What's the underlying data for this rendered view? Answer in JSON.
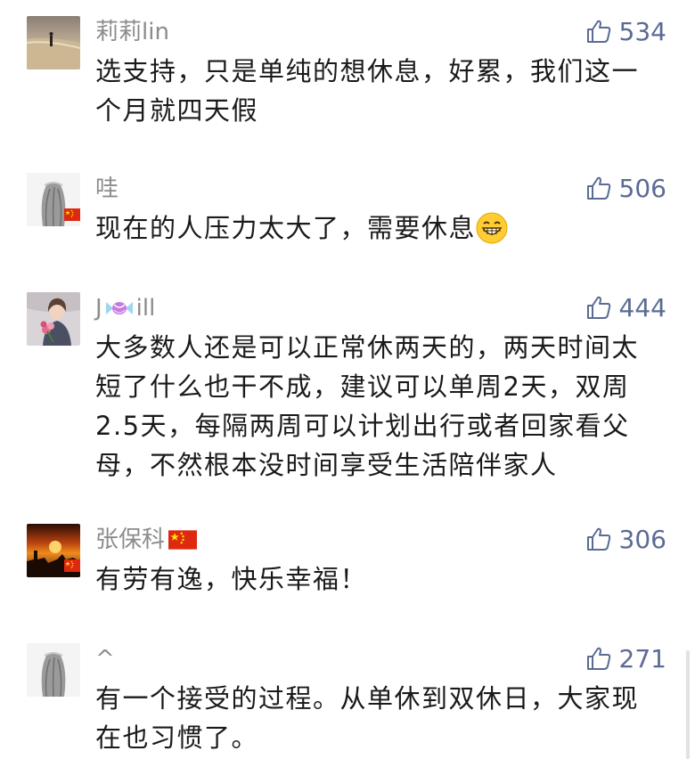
{
  "comments": [
    {
      "username": "莉莉lin",
      "likes": "534",
      "lines": [
        "选支持，只是单纯的想休息，好累，我们这一",
        "个月就四天假"
      ]
    },
    {
      "username": "哇",
      "likes": "506",
      "lines": [
        "现在的人压力太大了，需要休息"
      ],
      "emoji": "grinning-face-emoji"
    },
    {
      "username_prefix": "J",
      "username_suffix": "ill",
      "username_icon": "candy-icon",
      "likes": "444",
      "lines": [
        "大多数人还是可以正常休两天的，两天时间太",
        "短了什么也干不成，建议可以单周2天，双周",
        "2.5天，每隔两周可以计划出行或者回家看父",
        "母，不然根本没时间享受生活陪伴家人"
      ]
    },
    {
      "username": "张保科",
      "username_icon": "china-flag-icon",
      "likes": "306",
      "lines": [
        "有劳有逸，快乐幸福！"
      ]
    },
    {
      "username": "^",
      "likes": "271",
      "lines": [
        "有一个接受的过程。从单休到双休日，大家现",
        "在也习惯了。"
      ]
    }
  ],
  "colors": {
    "text": "#1a1a1a",
    "username": "#8c8c8c",
    "like": "#5b6b94",
    "flag_red": "#de2910",
    "flag_yellow": "#ffde00"
  }
}
